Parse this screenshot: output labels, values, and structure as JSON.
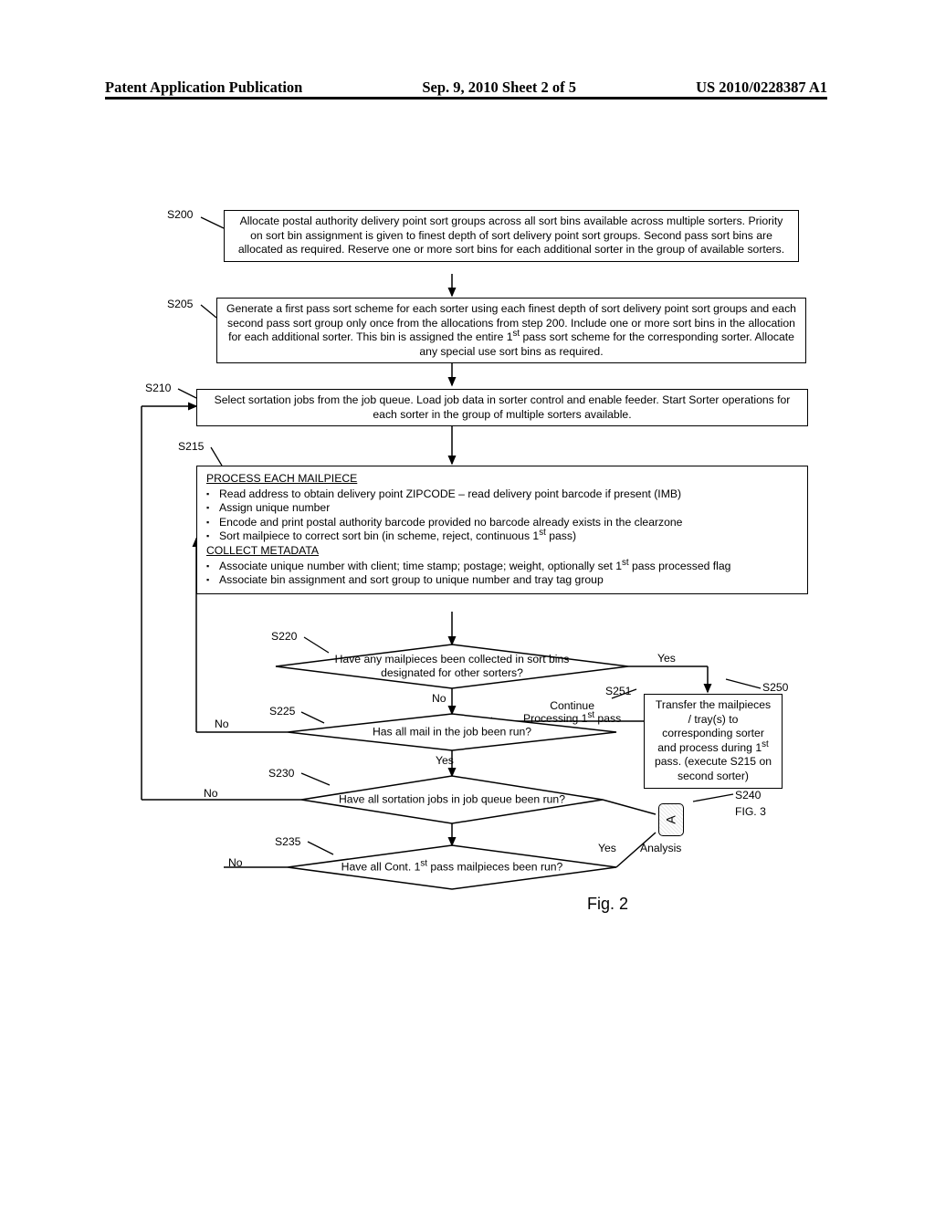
{
  "header": {
    "left": "Patent Application Publication",
    "center": "Sep. 9, 2010   Sheet 2 of 5",
    "right": "US 2010/0228387 A1"
  },
  "steps": {
    "s200": {
      "label": "S200",
      "text": "Allocate postal authority delivery point sort groups across all sort bins available across multiple sorters. Priority on sort bin assignment is given to finest depth of sort delivery point sort groups. Second pass sort bins are allocated as required. Reserve one or more sort bins for each additional sorter in the group of available sorters."
    },
    "s205": {
      "label": "S205",
      "text_pre": "Generate a first pass sort scheme for each sorter using each finest depth of sort delivery point sort groups and each second pass sort group only once from the allocations from step 200. Include one or more sort bins in the allocation for each additional sorter. This bin is assigned the entire 1",
      "sup1": "st",
      "text_post": " pass sort scheme for the corresponding sorter. Allocate any special use sort bins as required."
    },
    "s210": {
      "label": "S210",
      "text": "Select sortation jobs from the job queue. Load job data in sorter control and enable feeder. Start Sorter operations for each sorter in the group of multiple sorters available."
    },
    "s215": {
      "label": "S215",
      "head1": "PROCESS EACH MAILPIECE",
      "b1": "Read address to obtain delivery point ZIPCODE – read delivery point barcode if present (IMB)",
      "b2": "Assign unique number",
      "b3": "Encode and print postal authority barcode provided no barcode already exists in the clearzone",
      "b4_pre": "Sort mailpiece to correct sort bin (in scheme, reject, continuous 1",
      "b4_sup": "st",
      "b4_post": " pass)",
      "head2": "COLLECT METADATA",
      "b5_pre": "Associate unique number with client; time stamp; postage; weight, optionally set 1",
      "b5_sup": "st",
      "b5_post": " pass processed flag",
      "b6": "Associate bin assignment and sort group to unique number and tray tag group"
    },
    "s220": {
      "label": "S220",
      "text": "Have any mailpieces been collected in sort bins designated for other sorters?"
    },
    "s225": {
      "label": "S225",
      "text": "Has all mail in the job been run?"
    },
    "s230": {
      "label": "S230",
      "text": "Have all sortation jobs in job queue been run?"
    },
    "s235": {
      "label": "S235",
      "text_pre": "Have all Cont. 1",
      "sup": "st",
      "text_post": " pass mailpieces been run?"
    },
    "s240": {
      "label": "S240",
      "text": "Analysis",
      "fig_ref": "FIG. 3",
      "connector": "A"
    },
    "s250": {
      "label": "S250",
      "text_pre": "Transfer the mailpieces / tray(s) to corresponding sorter and process during 1",
      "sup": "st",
      "text_post": " pass. (execute S215 on second sorter)"
    },
    "s251": {
      "label": "S251",
      "text_pre": "Continue",
      "text_post": "Processing 1",
      "sup": "st",
      "tail": " pass"
    }
  },
  "branch": {
    "yes": "Yes",
    "no": "No"
  },
  "figure_caption": "Fig. 2"
}
